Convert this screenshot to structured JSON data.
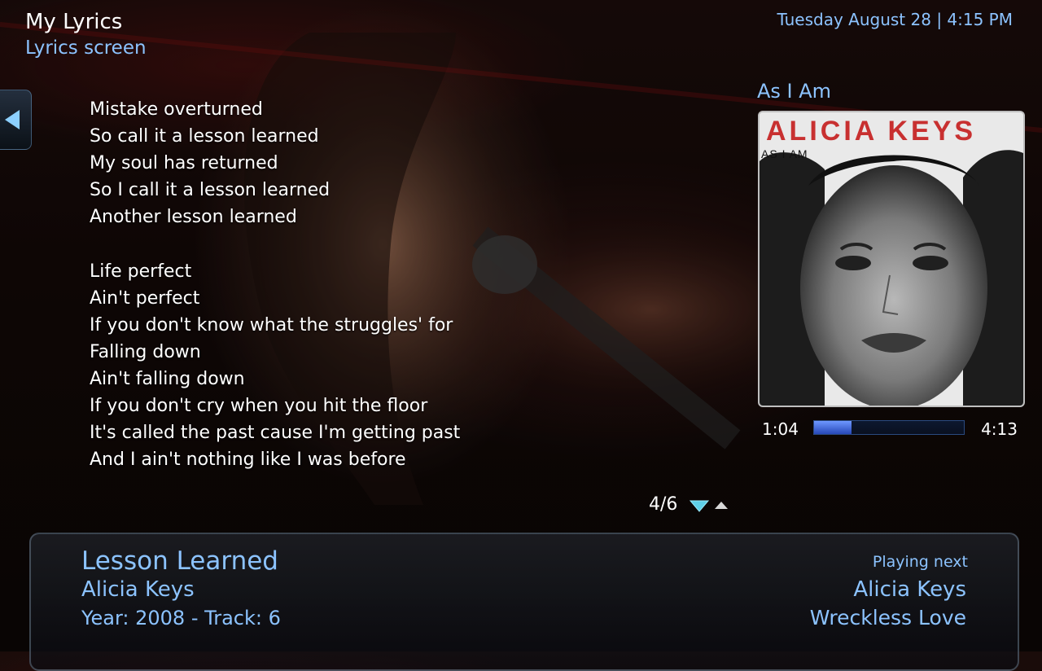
{
  "header": {
    "app_title": "My Lyrics",
    "screen_subtitle": "Lyrics screen",
    "datetime": "Tuesday August 28 | 4:15 PM"
  },
  "lyrics": [
    "Mistake overturned",
    "So call it a lesson learned",
    "My soul has returned",
    "So I call it a lesson learned",
    "Another lesson learned",
    "",
    "Life perfect",
    "Ain't perfect",
    "If you don't know what the struggles' for",
    "Falling down",
    "Ain't falling down",
    "If you don't cry when you hit the floor",
    "It's called the past cause I'm getting past",
    "And I ain't nothing like I was before"
  ],
  "album": {
    "name": "As I Am",
    "cover_artist_text": "ALICIA KEYS",
    "cover_album_text": "AS I AM"
  },
  "player": {
    "elapsed": "1:04",
    "total": "4:13",
    "progress": 0.25
  },
  "pagination": {
    "counter": "4/6"
  },
  "now_playing": {
    "title": "Lesson Learned",
    "artist": "Alicia Keys",
    "meta": "Year: 2008 - Track: 6"
  },
  "up_next": {
    "label": "Playing next",
    "artist": "Alicia Keys",
    "song": "Wreckless Love"
  },
  "icons": {
    "back": "left-arrow-icon",
    "page_down": "triangle-down-icon",
    "page_up": "triangle-up-icon"
  },
  "colors": {
    "accent_text": "#8cc3ff",
    "progress_fill": "#4a72e0"
  }
}
